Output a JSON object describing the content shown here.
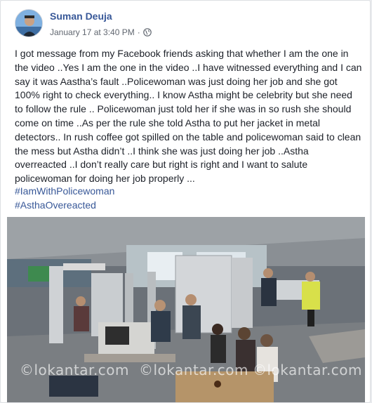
{
  "post": {
    "author": "Suman Deuja",
    "timestamp": "January 17 at 3:40 PM",
    "separator": "·",
    "privacy_icon": "globe-icon",
    "body": "I got message from my Facebook friends asking that whether I am the one in the video ..Yes I am the one in the video ..I have witnessed everything and I can say it was Aastha’s fault ..Policewoman was just doing her job and she got 100% right to check everything.. I know Astha might be celebrity but she need to follow the rule .. Policewoman just told her if she was in so rush she should come on time ..As per the rule she told Astha to put her jacket in metal detectors.. In rush coffee got spilled on the table and policewoman said to clean the mess but Astha didn’t ..I think she was just doing her job ..Astha overreacted ..I don’t really care but right is right and I want to salute policewoman for doing her job properly ...",
    "hashtags": [
      "#IamWithPolicewoman",
      "#AsthaOvereacted"
    ],
    "image": {
      "description": "security checkpoint CCTV photo",
      "watermarks": [
        "©lokantar.com",
        "©lokantar.com",
        "©lokantar.com"
      ]
    }
  },
  "colors": {
    "link": "#385898",
    "text": "#1d2129",
    "meta": "#616770"
  }
}
